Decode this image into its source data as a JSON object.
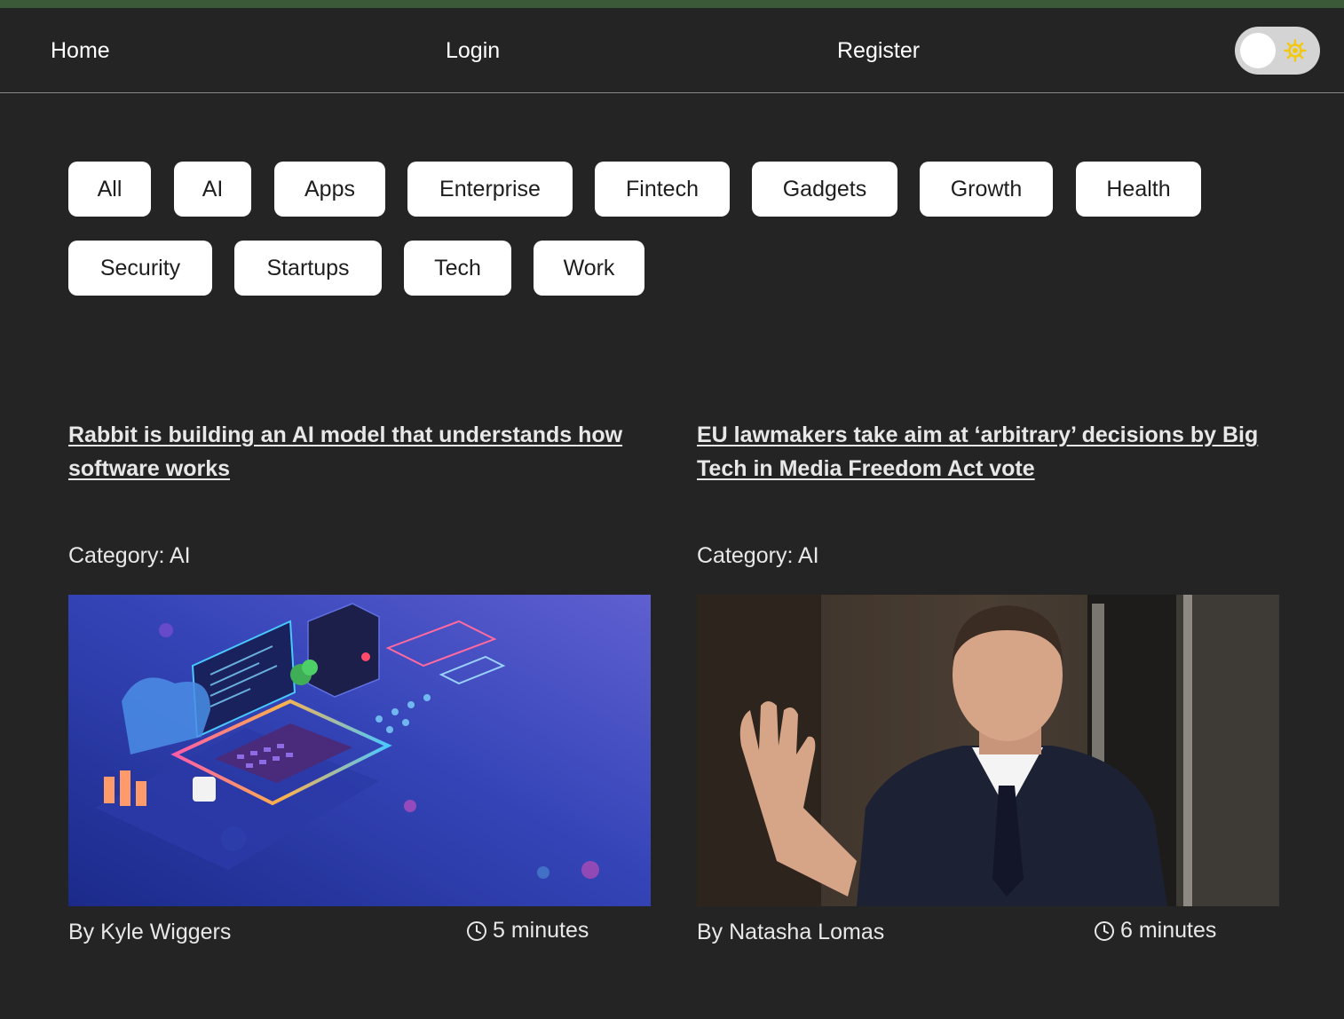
{
  "nav": {
    "home": "Home",
    "login": "Login",
    "register": "Register",
    "theme_icon": "sun-icon"
  },
  "categories": [
    "All",
    "AI",
    "Apps",
    "Enterprise",
    "Fintech",
    "Gadgets",
    "Growth",
    "Health",
    "Security",
    "Startups",
    "Tech",
    "Work"
  ],
  "articles": [
    {
      "title": "Rabbit is building an AI model that understands how software works",
      "category": "Category: AI",
      "author": "By Kyle Wiggers",
      "read_time": "5 minutes"
    },
    {
      "title": "EU lawmakers take aim at ‘arbitrary’ decisions by Big Tech in Media Freedom Act vote",
      "category": "Category: AI",
      "author": "By Natasha Lomas",
      "read_time": "6 minutes"
    }
  ],
  "colors": {
    "background": "#242424",
    "accent_strip": "#3b5a37",
    "button_bg": "#ffffff",
    "sun": "#f2c811"
  }
}
